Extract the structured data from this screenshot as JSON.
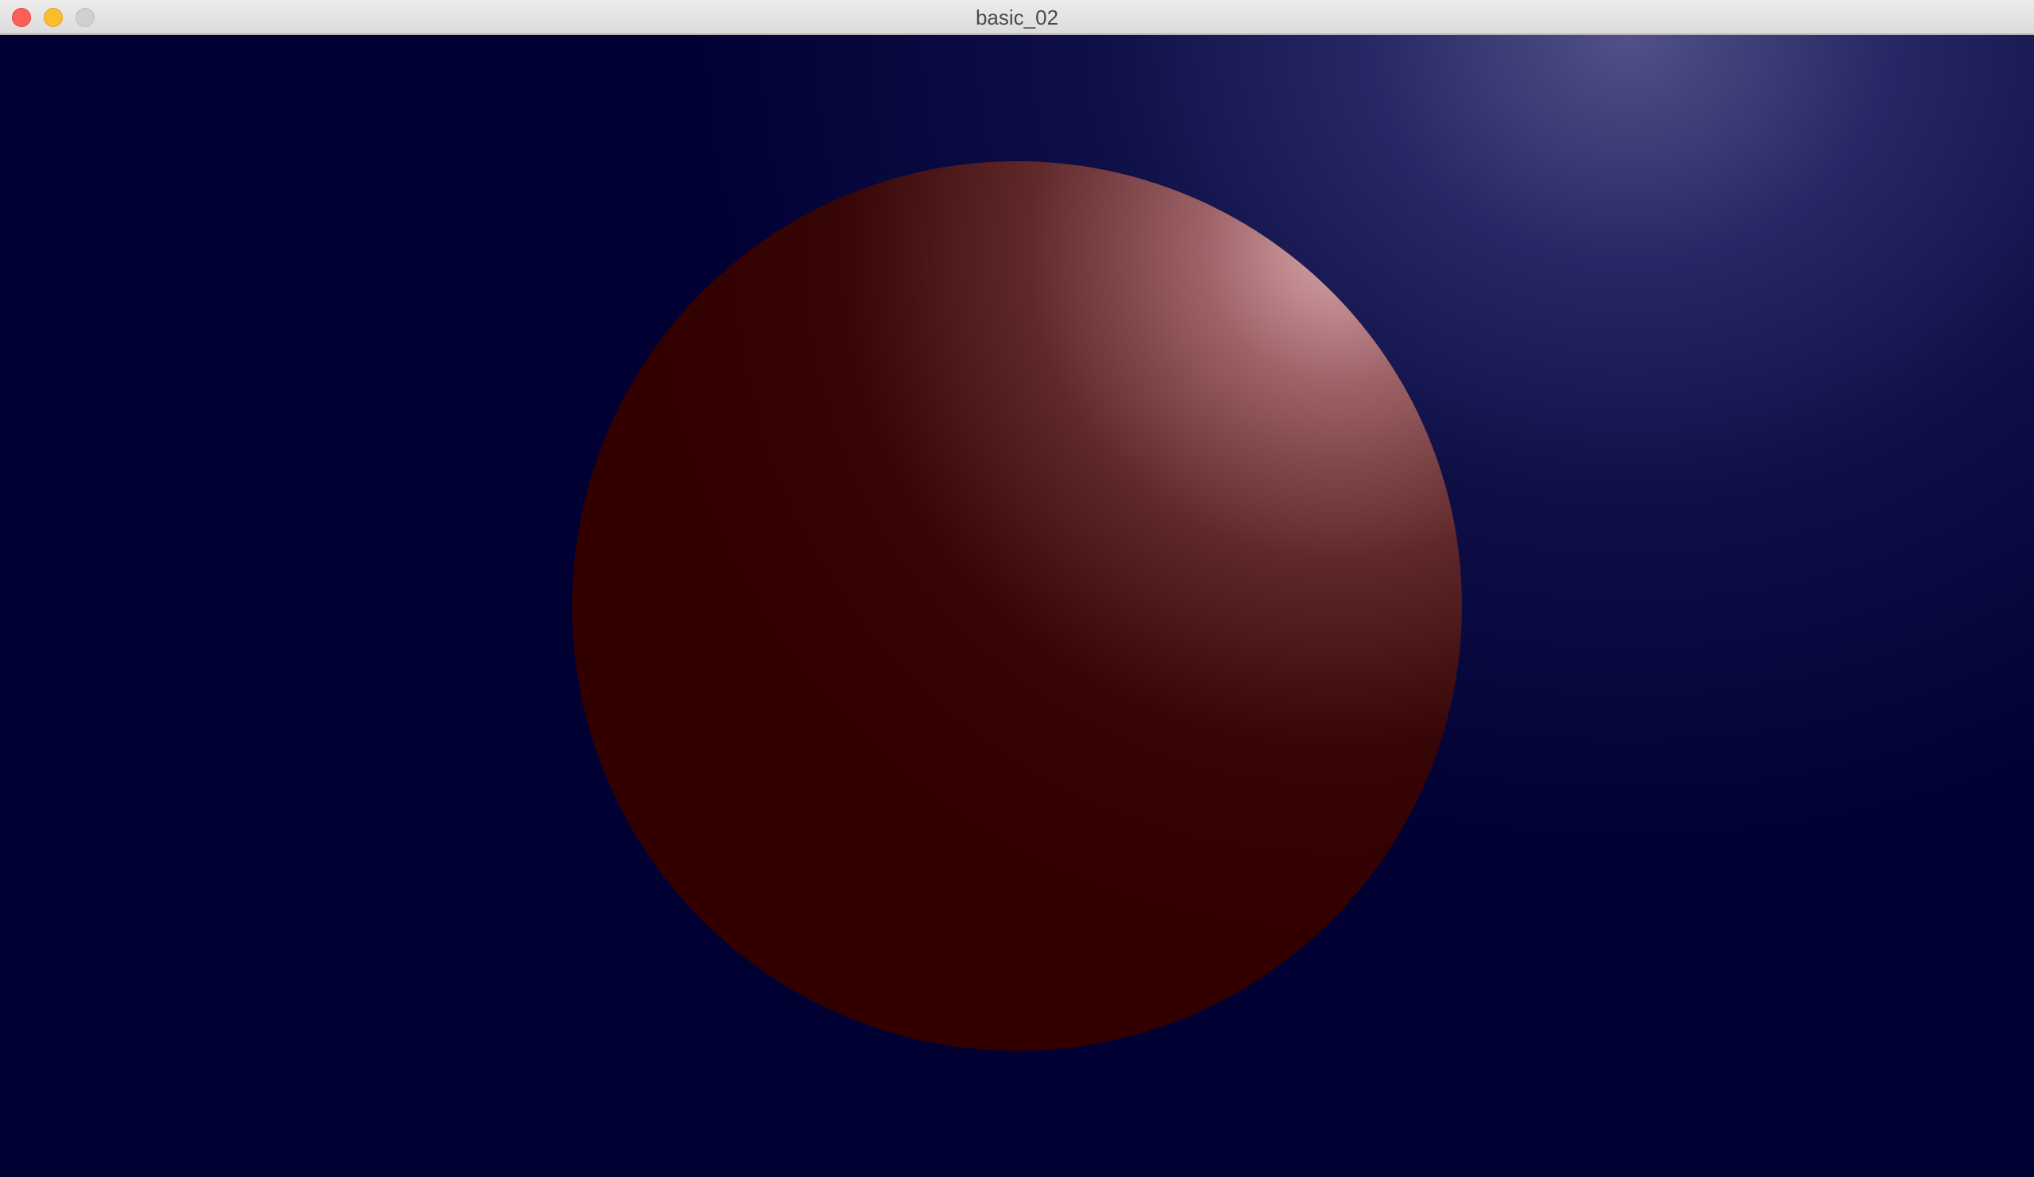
{
  "window": {
    "title": "basic_02",
    "controls": {
      "close": "close-icon",
      "minimize": "minimize-icon",
      "zoom": "zoom-icon"
    }
  },
  "scene": {
    "background_color": "#000033",
    "light_glow_color": "#56568c",
    "sphere": {
      "base_color": "#330000",
      "highlight_color": "#d7a5aa"
    }
  }
}
